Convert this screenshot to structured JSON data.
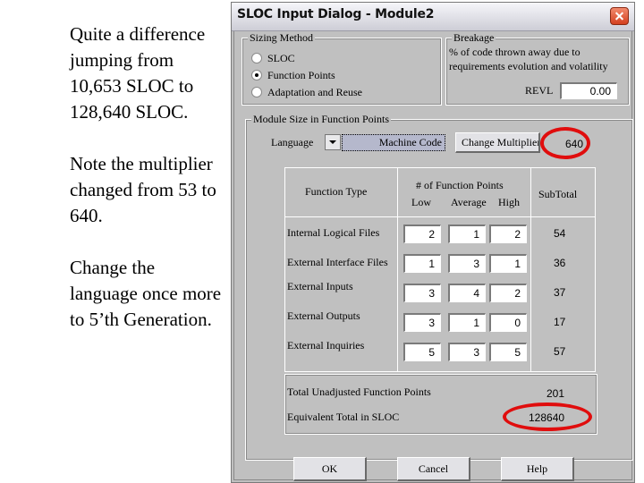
{
  "notes": [
    "Quite a difference jumping from 10,653 SLOC to 128,640 SLOC.",
    "Note the multiplier changed from 53 to 640.",
    "Change the language once more to 5’th Generation."
  ],
  "dialog": {
    "title": "SLOC Input Dialog - Module2",
    "close_icon": "close-x-icon",
    "sizing_method": {
      "label": "Sizing Method",
      "options": [
        {
          "label": "SLOC",
          "selected": false
        },
        {
          "label": "Function Points",
          "selected": true
        },
        {
          "label": "Adaptation and Reuse",
          "selected": false
        }
      ]
    },
    "breakage": {
      "label": "Breakage",
      "description_line1": "% of code thrown away due to",
      "description_line2": "requirements evolution and volatility",
      "revl_label": "REVL",
      "revl_value": "0.00"
    },
    "module_size": {
      "label": "Module Size in Function Points",
      "language_label": "Language",
      "language_value": "Machine Code",
      "change_multiplier_label": "Change Multiplier",
      "multiplier_value": "640",
      "table": {
        "header_function_type": "Function Type",
        "header_fp": "# of Function Points",
        "header_low": "Low",
        "header_average": "Average",
        "header_high": "High",
        "header_subtotal": "SubTotal",
        "rows": [
          {
            "type": "Internal Logical Files",
            "low": "2",
            "average": "1",
            "high": "2",
            "subtotal": "54"
          },
          {
            "type": "External Interface Files",
            "low": "1",
            "average": "3",
            "high": "1",
            "subtotal": "36"
          },
          {
            "type": "External Inputs",
            "low": "3",
            "average": "4",
            "high": "2",
            "subtotal": "37"
          },
          {
            "type": "External Outputs",
            "low": "3",
            "average": "1",
            "high": "0",
            "subtotal": "17"
          },
          {
            "type": "External Inquiries",
            "low": "5",
            "average": "3",
            "high": "5",
            "subtotal": "57"
          }
        ]
      },
      "total_ufp_label": "Total Unadjusted Function Points",
      "total_ufp_value": "201",
      "equiv_sloc_label": "Equivalent Total in SLOC",
      "equiv_sloc_value": "128640"
    },
    "buttons": {
      "ok": "OK",
      "cancel": "Cancel",
      "help": "Help"
    },
    "highlight_color": "#e00d0d"
  }
}
